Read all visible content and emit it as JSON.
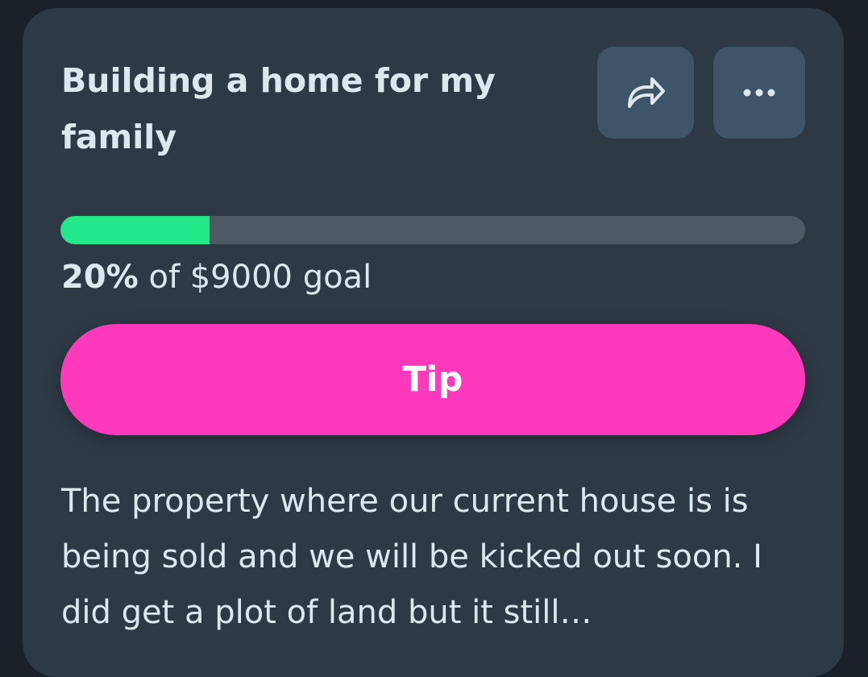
{
  "campaign": {
    "title": "Building a home for my family",
    "progress_percent": 20,
    "progress_label": "20%",
    "goal_text": " of $9000 goal",
    "tip_label": "Tip",
    "description": "The property where our current house is is being sold and we will be kicked out soon. I did get a plot of land but it still…"
  },
  "actions": {
    "share_icon": "share-icon",
    "more_icon": "more-options-icon"
  },
  "colors": {
    "background": "#1b2128",
    "card": "#2d3a45",
    "icon_button": "#3d5566",
    "progress_fill": "#23e98a",
    "progress_track": "#4e5a63",
    "tip_button": "#ff39bb",
    "text": "#dde7ee"
  }
}
